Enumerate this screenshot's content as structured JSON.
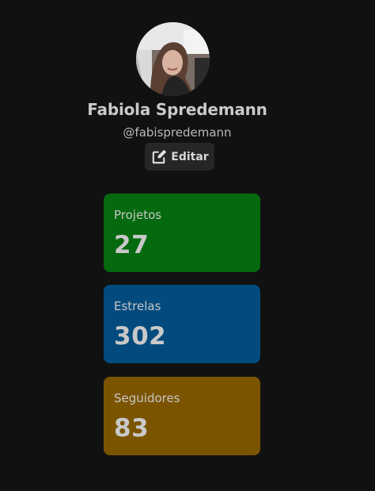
{
  "profile": {
    "name": "Fabiola Spredemann",
    "username": "@fabispredemann",
    "edit_label": "Editar"
  },
  "stats": [
    {
      "label": "Projetos",
      "value": "27",
      "color": "#056a0f"
    },
    {
      "label": "Estrelas",
      "value": "302",
      "color": "#034b7e"
    },
    {
      "label": "Seguidores",
      "value": "83",
      "color": "#7b5400"
    }
  ],
  "colors": {
    "background": "#111111",
    "button_bg": "#262626",
    "text": "#c9c9c9"
  },
  "icons": {
    "edit": "edit-icon"
  }
}
